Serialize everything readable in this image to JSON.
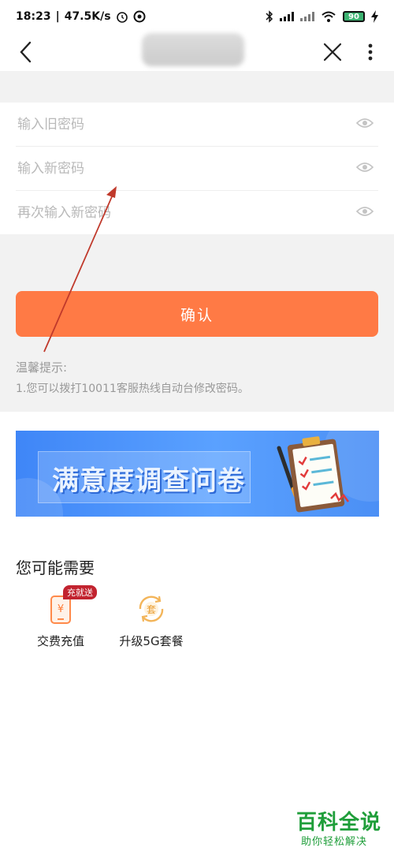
{
  "status_bar": {
    "time": "18:23",
    "speed": "47.5K/s",
    "battery": "90"
  },
  "nav": {
    "back_icon": "chevron-left-icon",
    "close_icon": "close-icon",
    "more_icon": "more-vertical-icon"
  },
  "form": {
    "old_password_placeholder": "输入旧密码",
    "new_password_placeholder": "输入新密码",
    "repeat_password_placeholder": "再次输入新密码",
    "eye_icon": "eye-icon"
  },
  "confirm_button": {
    "label": "确认",
    "color": "#ff7a45"
  },
  "tips": {
    "title": "温馨提示:",
    "line1": "1.您可以拨打10011客服热线自动台修改密码。"
  },
  "banner": {
    "text": "满意度调查问卷"
  },
  "suggest": {
    "title": "您可能需要",
    "items": [
      {
        "label": "交费充值",
        "badge": "充就送",
        "icon": "phone-payment-icon"
      },
      {
        "label": "升级5G套餐",
        "icon": "package-upgrade-icon"
      }
    ]
  },
  "watermark": {
    "main": "百科全说",
    "sub": "助你轻松解决"
  }
}
